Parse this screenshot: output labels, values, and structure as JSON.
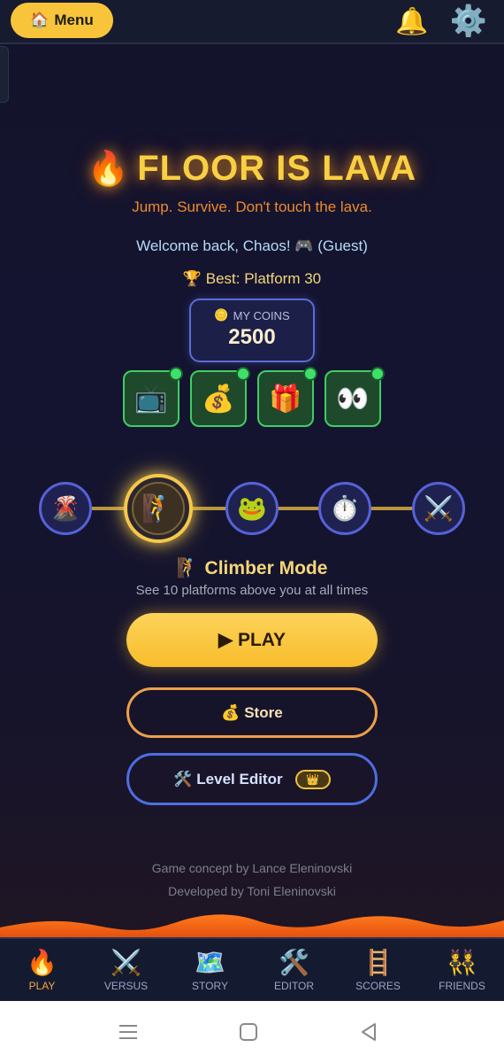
{
  "header": {
    "menu_icon": "house-icon",
    "menu_label": "Menu",
    "bell_icon": "bell-icon",
    "settings_icon": "gear-icon"
  },
  "title": {
    "icon": "fire-icon",
    "text": "FLOOR IS LAVA"
  },
  "tagline": "Jump. Survive. Don't touch the lava.",
  "welcome": "Welcome back, Chaos! 🎮 (Guest)",
  "best": "🏆 Best: Platform 30",
  "coins": {
    "label": "MY COINS",
    "value": "2500",
    "icon": "coin-icon"
  },
  "rewards": [
    {
      "icon": "tv-icon",
      "glyph": "📺",
      "has_dot": true
    },
    {
      "icon": "money-bag-icon",
      "glyph": "💰",
      "has_dot": true
    },
    {
      "icon": "gift-icon",
      "glyph": "🎁",
      "has_dot": true
    },
    {
      "icon": "eyes-icon",
      "glyph": "👀",
      "has_dot": true
    }
  ],
  "modes": [
    {
      "icon": "volcano-icon",
      "glyph": "🌋",
      "active": false
    },
    {
      "icon": "climber-icon",
      "glyph": "🧗",
      "active": true
    },
    {
      "icon": "frog-icon",
      "glyph": "🐸",
      "active": false
    },
    {
      "icon": "stopwatch-icon",
      "glyph": "⏱️",
      "active": false
    },
    {
      "icon": "crossed-swords-icon",
      "glyph": "⚔️",
      "active": false
    }
  ],
  "selected_mode": {
    "icon": "door-climber-icon",
    "title": "🧗 Climber Mode",
    "description": "See 10 platforms above you at all times"
  },
  "buttons": {
    "play": "▶ PLAY",
    "store": "💰 Store",
    "editor": "🛠️ Level Editor",
    "editor_badge": "👑"
  },
  "credits": {
    "concept": "Game concept by Lance Eleninovski",
    "developer": "Developed by Toni Eleninovski"
  },
  "nav": [
    {
      "icon": "fire-icon",
      "glyph": "🔥",
      "label": "PLAY",
      "active": true
    },
    {
      "icon": "crossed-swords-icon",
      "glyph": "⚔️",
      "label": "VERSUS",
      "active": false
    },
    {
      "icon": "map-icon",
      "glyph": "🗺️",
      "label": "STORY",
      "active": false
    },
    {
      "icon": "hammer-wrench-icon",
      "glyph": "🛠️",
      "label": "EDITOR",
      "active": false
    },
    {
      "icon": "ladder-icon",
      "glyph": "🪜",
      "label": "SCORES",
      "active": false
    },
    {
      "icon": "people-icon",
      "glyph": "👯",
      "label": "FRIENDS",
      "active": false
    }
  ],
  "colors": {
    "accent_gold": "#f9cf43",
    "lava_orange": "#ee8a2c",
    "play_yellow": "#f8bd2c",
    "reward_green": "#3fce63",
    "mode_blue": "#5562d8"
  }
}
